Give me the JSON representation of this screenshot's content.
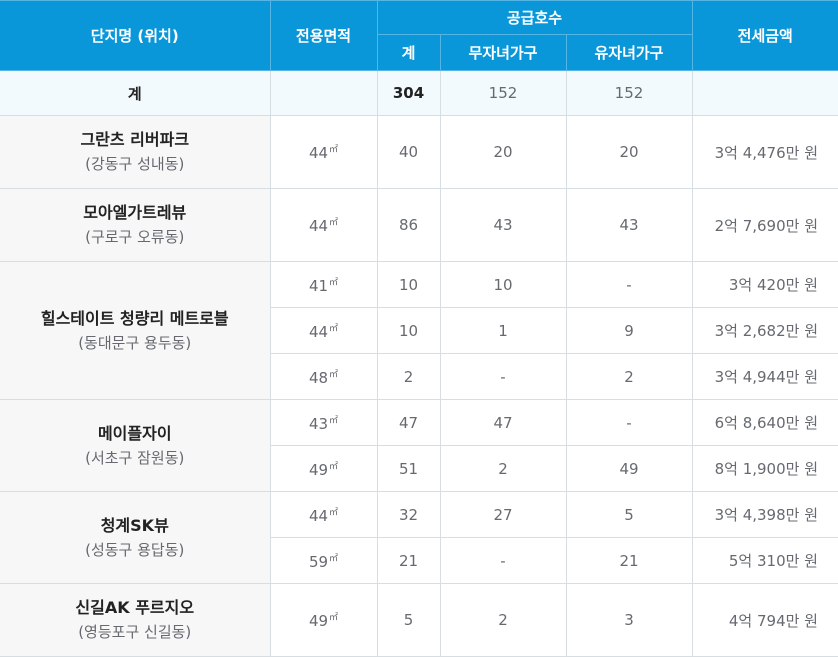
{
  "header": {
    "complex": "단지명 (위치)",
    "area": "전용면적",
    "supply": "공급호수",
    "total": "계",
    "childless": "무자녀가구",
    "with_children": "유자녀가구",
    "deposit": "전세금액"
  },
  "summary": {
    "label": "계",
    "total": "304",
    "childless": "152",
    "with_children": "152"
  },
  "area_unit": "㎡",
  "complexes": [
    {
      "name": "그란츠 리버파크",
      "location": "(강동구 성내동)",
      "rows": [
        {
          "area": "44",
          "total": "40",
          "childless": "20",
          "with_children": "20",
          "deposit": "3억 4,476만 원"
        }
      ]
    },
    {
      "name": "모아엘가트레뷰",
      "location": "(구로구 오류동)",
      "rows": [
        {
          "area": "44",
          "total": "86",
          "childless": "43",
          "with_children": "43",
          "deposit": "2억 7,690만 원"
        }
      ]
    },
    {
      "name": "힐스테이트 청량리 메트로블",
      "location": "(동대문구 용두동)",
      "rows": [
        {
          "area": "41",
          "total": "10",
          "childless": "10",
          "with_children": "-",
          "deposit": "3억 420만 원"
        },
        {
          "area": "44",
          "total": "10",
          "childless": "1",
          "with_children": "9",
          "deposit": "3억 2,682만 원"
        },
        {
          "area": "48",
          "total": "2",
          "childless": "-",
          "with_children": "2",
          "deposit": "3억 4,944만 원"
        }
      ]
    },
    {
      "name": "메이플자이",
      "location": "(서초구 잠원동)",
      "rows": [
        {
          "area": "43",
          "total": "47",
          "childless": "47",
          "with_children": "-",
          "deposit": "6억 8,640만 원"
        },
        {
          "area": "49",
          "total": "51",
          "childless": "2",
          "with_children": "49",
          "deposit": "8억 1,900만 원"
        }
      ]
    },
    {
      "name": "청계SK뷰",
      "location": "(성동구 용답동)",
      "rows": [
        {
          "area": "44",
          "total": "32",
          "childless": "27",
          "with_children": "5",
          "deposit": "3억 4,398만 원"
        },
        {
          "area": "59",
          "total": "21",
          "childless": "-",
          "with_children": "21",
          "deposit": "5억 310만 원"
        }
      ]
    },
    {
      "name": "신길AK 푸르지오",
      "location": "(영등포구 신길동)",
      "rows": [
        {
          "area": "49",
          "total": "5",
          "childless": "2",
          "with_children": "3",
          "deposit": "4억 794만 원"
        }
      ]
    }
  ]
}
